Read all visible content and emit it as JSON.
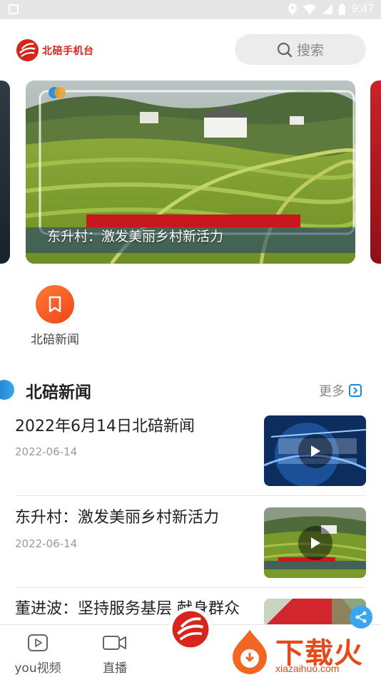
{
  "status_bar": {
    "time": "9:47"
  },
  "header": {
    "logo_text": "北碚手机台",
    "search_placeholder": "搜索"
  },
  "banner": {
    "caption": "东升村：激发美丽乡村新活力"
  },
  "shortcuts": [
    {
      "label": "北碚新闻",
      "icon": "bookmark-icon"
    }
  ],
  "section": {
    "title": "北碚新闻",
    "more_label": "更多"
  },
  "news": [
    {
      "title": "2022年6月14日北碚新闻",
      "date": "2022-06-14",
      "thumb": "news-studio"
    },
    {
      "title": "东升村：激发美丽乡村新活力",
      "date": "2022-06-14",
      "thumb": "rice-terrace"
    },
    {
      "title": "董进波：坚持服务基层 献身群众",
      "date": "",
      "thumb": "red-building"
    }
  ],
  "bottom_nav": {
    "items": [
      {
        "label": "you视频",
        "icon": "play-square-icon"
      },
      {
        "label": "直播",
        "icon": "video-camera-icon"
      }
    ]
  },
  "watermark": {
    "brand": "下载火",
    "url": "xiazaihuo.com"
  },
  "colors": {
    "brand_red": "#d9241b",
    "accent_blue": "#1f7cc9",
    "shortcut_orange": "#f0451b"
  }
}
